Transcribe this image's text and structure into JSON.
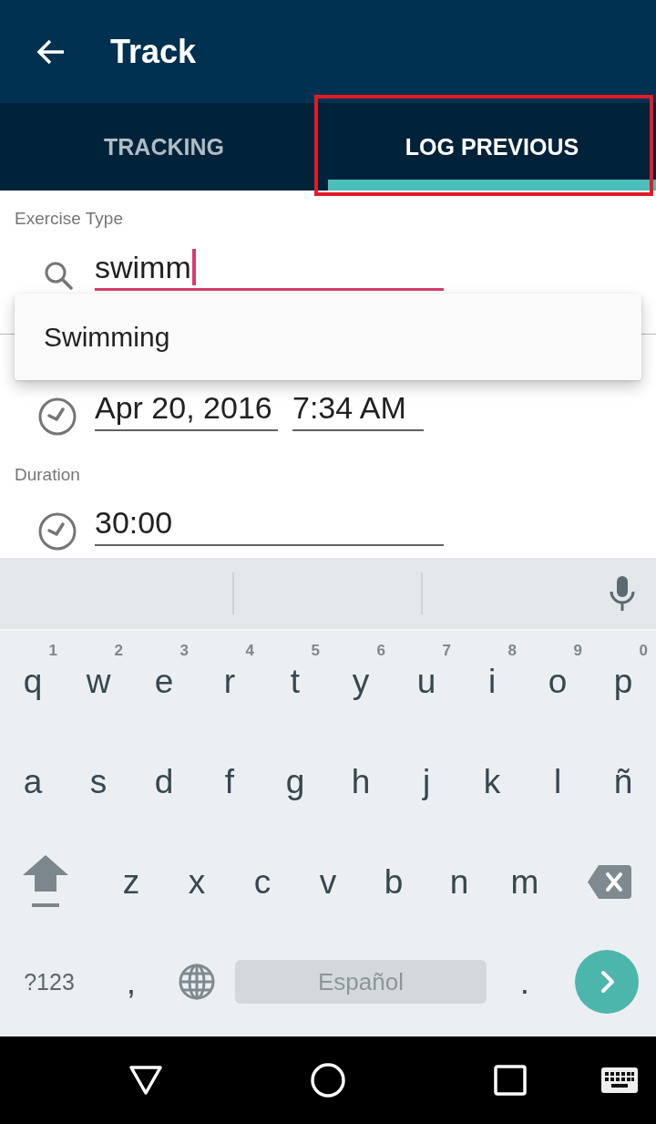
{
  "app_bar": {
    "title": "Track"
  },
  "tabs": [
    {
      "label": "TRACKING",
      "selected": false,
      "highlighted": false
    },
    {
      "label": "LOG PREVIOUS",
      "selected": true,
      "highlighted": true
    }
  ],
  "exercise_type": {
    "label": "Exercise Type",
    "value": "swimm",
    "focused": true,
    "suggestions": [
      {
        "label": "Swimming"
      }
    ]
  },
  "start": {
    "fields": [
      {
        "kind": "date",
        "value": "Apr 20, 2016",
        "focused": false
      },
      {
        "kind": "time",
        "value": "7:34 AM",
        "focused": false
      }
    ]
  },
  "duration": {
    "label": "Duration",
    "value": "30:00",
    "focused": false
  },
  "keyboard": {
    "rows": [
      {
        "keys": [
          {
            "kind": "letter",
            "label": "q",
            "hint": "1"
          },
          {
            "kind": "letter",
            "label": "w",
            "hint": "2"
          },
          {
            "kind": "letter",
            "label": "e",
            "hint": "3"
          },
          {
            "kind": "letter",
            "label": "r",
            "hint": "4"
          },
          {
            "kind": "letter",
            "label": "t",
            "hint": "5"
          },
          {
            "kind": "letter",
            "label": "y",
            "hint": "6"
          },
          {
            "kind": "letter",
            "label": "u",
            "hint": "7"
          },
          {
            "kind": "letter",
            "label": "i",
            "hint": "8"
          },
          {
            "kind": "letter",
            "label": "o",
            "hint": "9"
          },
          {
            "kind": "letter",
            "label": "p",
            "hint": "0"
          }
        ]
      },
      {
        "keys": [
          {
            "kind": "letter",
            "label": "a"
          },
          {
            "kind": "letter",
            "label": "s"
          },
          {
            "kind": "letter",
            "label": "d"
          },
          {
            "kind": "letter",
            "label": "f"
          },
          {
            "kind": "letter",
            "label": "g"
          },
          {
            "kind": "letter",
            "label": "h"
          },
          {
            "kind": "letter",
            "label": "j"
          },
          {
            "kind": "letter",
            "label": "k"
          },
          {
            "kind": "letter",
            "label": "l"
          },
          {
            "kind": "letter",
            "label": "ñ"
          }
        ]
      },
      {
        "keys": [
          {
            "kind": "shift"
          },
          {
            "kind": "letter",
            "label": "z"
          },
          {
            "kind": "letter",
            "label": "x"
          },
          {
            "kind": "letter",
            "label": "c"
          },
          {
            "kind": "letter",
            "label": "v"
          },
          {
            "kind": "letter",
            "label": "b"
          },
          {
            "kind": "letter",
            "label": "n"
          },
          {
            "kind": "letter",
            "label": "m"
          },
          {
            "kind": "backspace"
          }
        ]
      },
      {
        "keys": [
          {
            "kind": "symbols",
            "label": "?123"
          },
          {
            "kind": "letter",
            "label": ","
          },
          {
            "kind": "language"
          },
          {
            "kind": "space",
            "label": "Español"
          },
          {
            "kind": "letter",
            "label": "."
          },
          {
            "kind": "enter"
          }
        ]
      }
    ]
  }
}
